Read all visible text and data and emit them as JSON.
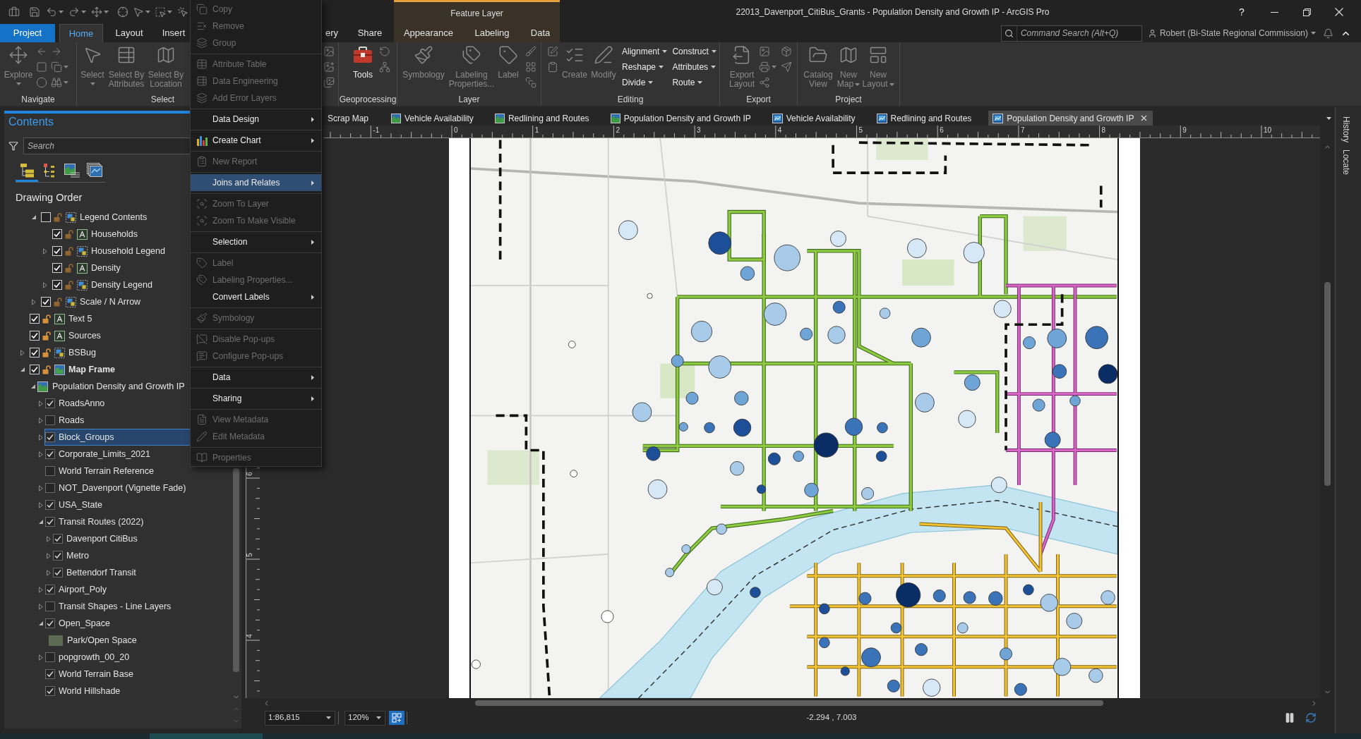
{
  "window": {
    "title": "22013_Davenport_CitiBus_Grants - Population Density and Growth IP - ArcGIS Pro",
    "help": "?"
  },
  "ribbon_tabs": [
    {
      "label": "Project",
      "kind": "file",
      "selected": false
    },
    {
      "label": "Home",
      "kind": "tab",
      "selected": true
    },
    {
      "label": "Layout",
      "kind": "tab",
      "selected": false
    },
    {
      "label": "Insert",
      "kind": "tab",
      "selected": false
    },
    {
      "label": "ery",
      "kind": "tab",
      "selected": false
    },
    {
      "label": "Share",
      "kind": "tab",
      "selected": false
    }
  ],
  "contextual_tabs": {
    "label": "Feature Layer",
    "tabs": [
      {
        "label": "Appearance",
        "selected": false
      },
      {
        "label": "Labeling",
        "selected": false
      },
      {
        "label": "Data",
        "selected": false
      }
    ]
  },
  "command_search": {
    "placeholder": "Command Search (Alt+Q)"
  },
  "user": {
    "name": "Robert (Bi-State Regional Commission)"
  },
  "ribbon_groups": [
    {
      "label": "Navigate",
      "buttons": [
        {
          "label": "Explore",
          "kind": "large",
          "disabled": true,
          "dropdown": true
        }
      ]
    },
    {
      "label": "Select",
      "buttons": [
        {
          "label": "Select",
          "kind": "large",
          "disabled": true,
          "dropdown": true
        },
        {
          "label": "Select By\nAttributes",
          "kind": "large",
          "disabled": true,
          "dropdown": false
        },
        {
          "label": "Select By\nLocation",
          "kind": "large",
          "disabled": true,
          "dropdown": false
        }
      ]
    },
    {
      "label": "Geoprocessing",
      "buttons": [
        {
          "label": "Tools",
          "kind": "large",
          "disabled": false,
          "dropdown": false
        }
      ]
    },
    {
      "label": "Layer",
      "buttons": [
        {
          "label": "Symbology",
          "kind": "large",
          "disabled": true,
          "dropdown": false
        },
        {
          "label": "Labeling\nProperties...",
          "kind": "large",
          "disabled": true,
          "dropdown": false
        },
        {
          "label": "Label",
          "kind": "large",
          "disabled": true,
          "dropdown": false
        }
      ]
    },
    {
      "label": "Editing",
      "buttons": [
        {
          "label": "Create",
          "kind": "large",
          "disabled": true,
          "dropdown": false
        },
        {
          "label": "Modify",
          "kind": "large",
          "disabled": true,
          "dropdown": false
        },
        {
          "label": "Alignment",
          "kind": "menu",
          "disabled": false,
          "dropdown": true
        },
        {
          "label": "Reshape",
          "kind": "menu",
          "disabled": false,
          "dropdown": true
        },
        {
          "label": "Divide",
          "kind": "menu",
          "disabled": false,
          "dropdown": true
        },
        {
          "label": "Construct",
          "kind": "menu",
          "disabled": false,
          "dropdown": true
        },
        {
          "label": "Attributes",
          "kind": "menu",
          "disabled": false,
          "dropdown": true
        },
        {
          "label": "Route",
          "kind": "menu",
          "disabled": false,
          "dropdown": true
        }
      ]
    },
    {
      "label": "Export",
      "buttons": [
        {
          "label": "Export\nLayout",
          "kind": "large",
          "disabled": true,
          "dropdown": false
        }
      ]
    },
    {
      "label": "Project",
      "buttons": [
        {
          "label": "Catalog\nView",
          "kind": "large",
          "disabled": true,
          "dropdown": false
        },
        {
          "label": "New\nMap",
          "kind": "large",
          "disabled": true,
          "dropdown": true
        },
        {
          "label": "New\nLayout",
          "kind": "large",
          "disabled": true,
          "dropdown": true
        }
      ]
    }
  ],
  "context_menu": {
    "sections": [
      {
        "items": [
          {
            "label": "Copy",
            "disabled": true,
            "submenu": false,
            "selected": false
          },
          {
            "label": "Remove",
            "disabled": true,
            "submenu": false,
            "selected": false
          },
          {
            "label": "Group",
            "disabled": true,
            "submenu": false,
            "selected": false
          }
        ]
      },
      {
        "items": [
          {
            "label": "Attribute Table",
            "disabled": true,
            "submenu": false,
            "selected": false
          },
          {
            "label": "Data Engineering",
            "disabled": true,
            "submenu": false,
            "selected": false
          },
          {
            "label": "Add Error Layers",
            "disabled": true,
            "submenu": false,
            "selected": false
          }
        ]
      },
      {
        "items": [
          {
            "label": "Data Design",
            "disabled": false,
            "submenu": true,
            "selected": false
          }
        ]
      },
      {
        "items": [
          {
            "label": "Create Chart",
            "disabled": false,
            "submenu": true,
            "selected": false
          }
        ]
      },
      {
        "items": [
          {
            "label": "New Report",
            "disabled": true,
            "submenu": false,
            "selected": false
          }
        ]
      },
      {
        "items": [
          {
            "label": "Joins and Relates",
            "disabled": false,
            "submenu": true,
            "selected": true
          }
        ]
      },
      {
        "items": [
          {
            "label": "Zoom To Layer",
            "disabled": true,
            "submenu": false,
            "selected": false
          },
          {
            "label": "Zoom To Make Visible",
            "disabled": true,
            "submenu": false,
            "selected": false
          }
        ]
      },
      {
        "items": [
          {
            "label": "Selection",
            "disabled": false,
            "submenu": true,
            "selected": false
          }
        ]
      },
      {
        "items": [
          {
            "label": "Label",
            "disabled": true,
            "submenu": false,
            "selected": false
          },
          {
            "label": "Labeling Properties...",
            "disabled": true,
            "submenu": false,
            "selected": false
          },
          {
            "label": "Convert Labels",
            "disabled": false,
            "submenu": true,
            "selected": false
          }
        ]
      },
      {
        "items": [
          {
            "label": "Symbology",
            "disabled": true,
            "submenu": false,
            "selected": false
          }
        ]
      },
      {
        "items": [
          {
            "label": "Disable Pop-ups",
            "disabled": true,
            "submenu": false,
            "selected": false
          },
          {
            "label": "Configure Pop-ups",
            "disabled": true,
            "submenu": false,
            "selected": false
          }
        ]
      },
      {
        "items": [
          {
            "label": "Data",
            "disabled": false,
            "submenu": true,
            "selected": false
          }
        ]
      },
      {
        "items": [
          {
            "label": "Sharing",
            "disabled": false,
            "submenu": true,
            "selected": false
          }
        ]
      },
      {
        "items": [
          {
            "label": "View Metadata",
            "disabled": true,
            "submenu": false,
            "selected": false
          },
          {
            "label": "Edit Metadata",
            "disabled": true,
            "submenu": false,
            "selected": false
          }
        ]
      },
      {
        "items": [
          {
            "label": "Properties",
            "disabled": true,
            "submenu": false,
            "selected": false
          }
        ]
      }
    ]
  },
  "contents": {
    "title": "Contents",
    "search": {
      "placeholder": "Search"
    },
    "view_buttons": [
      {
        "selected": true
      },
      {
        "selected": false
      },
      {
        "selected": false
      },
      {
        "selected": false
      }
    ],
    "heading": "Drawing Order",
    "tree": [
      {
        "children": [
          {
            "label": "Legend Contents",
            "kind": "group",
            "checked": false,
            "expanded": true,
            "selected": false,
            "children": [
              {
                "label": "Households",
                "kind": "text",
                "checked": true,
                "selected": false
              },
              {
                "label": "Household Legend",
                "kind": "group",
                "checked": true,
                "expanded": false,
                "selected": false
              },
              {
                "label": "Density",
                "kind": "text",
                "checked": true,
                "selected": false
              },
              {
                "label": "Density Legend",
                "kind": "group",
                "checked": true,
                "expanded": false,
                "selected": false
              }
            ]
          },
          {
            "label": "Scale / N Arrow",
            "kind": "group",
            "checked": true,
            "expanded": false,
            "selected": false
          }
        ]
      },
      {
        "label": "Text 5",
        "kind": "text",
        "checked": true,
        "selected": false
      },
      {
        "label": "Sources",
        "kind": "text",
        "checked": true,
        "selected": false
      },
      {
        "label": "BSBug",
        "kind": "group",
        "checked": true,
        "expanded": false,
        "selected": false
      },
      {
        "label": "Map Frame",
        "kind": "map_frame",
        "checked": true,
        "expanded": true,
        "selected": false,
        "active": true,
        "children": [
          {
            "label": "Population Density and Growth IP",
            "kind": "map",
            "expanded": true,
            "selected": false,
            "children": [
              {
                "label": "RoadsAnno",
                "kind": "layer",
                "checked": true,
                "expanded": false,
                "selected": false
              },
              {
                "label": "Roads",
                "kind": "layer",
                "checked": false,
                "expanded": false,
                "selected": false
              },
              {
                "label": "Block_Groups",
                "kind": "layer",
                "checked": true,
                "expanded": false,
                "selected": true
              },
              {
                "label": "Corporate_Limits_2021",
                "kind": "layer",
                "checked": true,
                "expanded": false,
                "selected": false
              },
              {
                "label": "World Terrain Reference",
                "kind": "layer",
                "checked": false,
                "selected": false
              },
              {
                "label": "NOT_Davenport (Vignette Fade)",
                "kind": "layer",
                "checked": false,
                "expanded": false,
                "selected": false
              },
              {
                "label": "USA_State",
                "kind": "layer",
                "checked": true,
                "expanded": false,
                "selected": false
              },
              {
                "label": "Transit Routes (2022)",
                "kind": "layer",
                "checked": true,
                "expanded": true,
                "selected": false,
                "children": [
                  {
                    "label": "Davenport CitiBus",
                    "kind": "layer",
                    "checked": true,
                    "expanded": false,
                    "selected": false
                  },
                  {
                    "label": "Metro",
                    "kind": "layer",
                    "checked": true,
                    "expanded": false,
                    "selected": false
                  },
                  {
                    "label": "Bettendorf Transit",
                    "kind": "layer",
                    "checked": true,
                    "expanded": false,
                    "selected": false
                  }
                ]
              },
              {
                "label": "Airport_Poly",
                "kind": "layer",
                "checked": true,
                "expanded": false,
                "selected": false
              },
              {
                "label": "Transit Shapes - Line Layers",
                "kind": "layer",
                "checked": false,
                "expanded": false,
                "selected": false
              },
              {
                "label": "Open_Space",
                "kind": "layer",
                "checked": true,
                "expanded": true,
                "selected": false,
                "children": [
                  {
                    "label": "Park/Open Space",
                    "kind": "legend_patch",
                    "color": "#5d6b55",
                    "selected": false
                  }
                ]
              },
              {
                "label": "popgrowth_00_20",
                "kind": "layer",
                "checked": false,
                "expanded": false,
                "selected": false
              },
              {
                "label": "World Terrain Base",
                "kind": "layer",
                "checked": true,
                "selected": false
              },
              {
                "label": "World Hillshade",
                "kind": "layer",
                "checked": true,
                "selected": false
              }
            ]
          }
        ]
      }
    ]
  },
  "document_tabs": [
    {
      "label": "Scrap Map",
      "kind": "clipped",
      "selected": false
    },
    {
      "label": "Vehicle Availability",
      "kind": "map",
      "selected": false
    },
    {
      "label": "Redlining and Routes",
      "kind": "map",
      "selected": false
    },
    {
      "label": "Population Density and Growth IP",
      "kind": "map",
      "selected": false
    },
    {
      "label": "Vehicle Availability",
      "kind": "layout",
      "selected": false
    },
    {
      "label": "Redlining and Routes",
      "kind": "layout",
      "selected": false
    },
    {
      "label": "Population Density and Growth IP",
      "kind": "layout",
      "selected": true
    }
  ],
  "rulers": {
    "horizontal": [
      "-1",
      "0",
      "1",
      "2",
      "3",
      "4",
      "5",
      "6",
      "7",
      "8",
      "9",
      "10"
    ],
    "vertical": [
      "6",
      "5",
      "4"
    ]
  },
  "status_bar": {
    "scale": "1:86,815",
    "zoom": "120%",
    "coordinates": "-2.294 , 7.003"
  },
  "side_tabs": [
    {
      "label": "History"
    },
    {
      "label": "Locate"
    }
  ]
}
